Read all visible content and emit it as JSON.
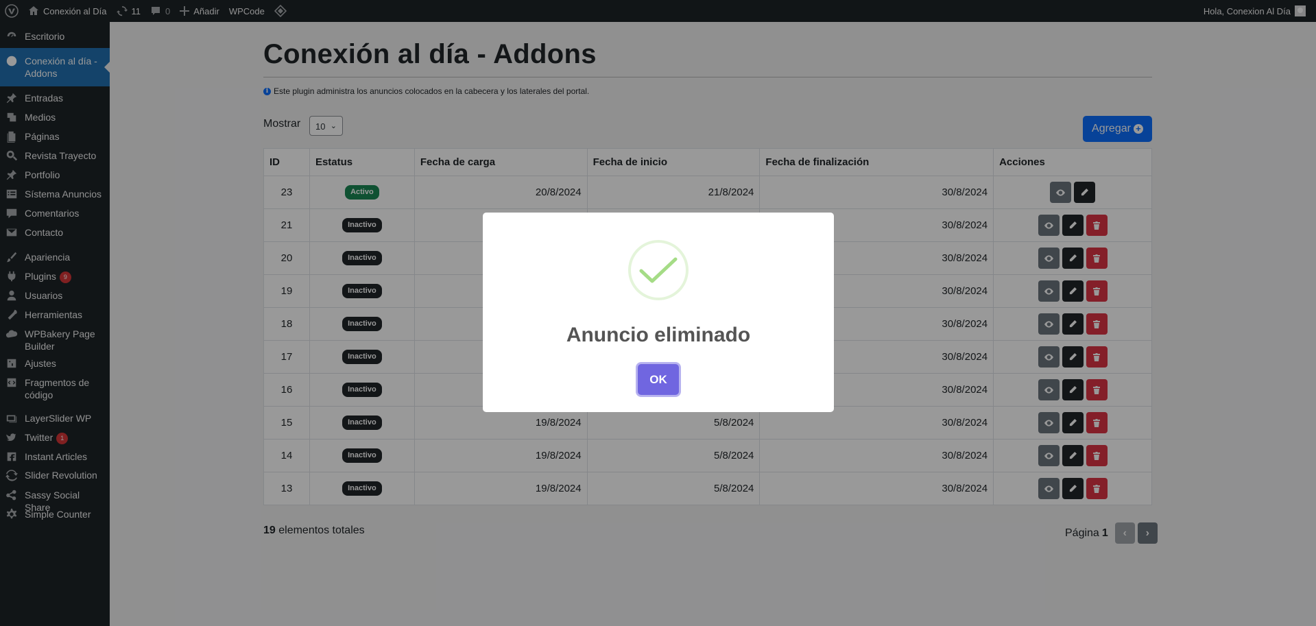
{
  "adminbar": {
    "site_name": "Conexión al Día",
    "updates_count": "11",
    "comments_count": "0",
    "add_new_label": "Añadir",
    "wpcode_label": "WPCode",
    "greeting": "Hola, Conexion Al Día"
  },
  "sidebar": {
    "items": [
      {
        "label": "Escritorio",
        "icon": "dashboard-icon"
      },
      {
        "label": "Conexión al día - Addons",
        "icon": "addons-icon",
        "current": true
      },
      {
        "label": "Entradas",
        "icon": "pin-icon"
      },
      {
        "label": "Medios",
        "icon": "media-icon"
      },
      {
        "label": "Páginas",
        "icon": "pages-icon"
      },
      {
        "label": "Revista Trayecto",
        "icon": "magnify-icon"
      },
      {
        "label": "Portfolio",
        "icon": "pin-icon"
      },
      {
        "label": "Sístema Anuncios",
        "icon": "list-icon"
      },
      {
        "label": "Comentarios",
        "icon": "comment-icon"
      },
      {
        "label": "Contacto",
        "icon": "mail-icon"
      },
      {
        "label": "Apariencia",
        "icon": "brush-icon"
      },
      {
        "label": "Plugins",
        "icon": "plugin-icon",
        "badge": "9"
      },
      {
        "label": "Usuarios",
        "icon": "user-icon"
      },
      {
        "label": "Herramientas",
        "icon": "wrench-icon"
      },
      {
        "label": "WPBakery Page Builder",
        "icon": "cloud-icon"
      },
      {
        "label": "Ajustes",
        "icon": "settings-icon"
      },
      {
        "label": "Fragmentos de código",
        "icon": "code-icon"
      },
      {
        "label": "LayerSlider WP",
        "icon": "layers-icon"
      },
      {
        "label": "Twitter",
        "icon": "twitter-icon",
        "badge": "1"
      },
      {
        "label": "Instant Articles",
        "icon": "facebook-icon"
      },
      {
        "label": "Slider Revolution",
        "icon": "refresh-icon"
      },
      {
        "label": "Sassy Social Share",
        "icon": "share-icon"
      },
      {
        "label": "Simple Counter",
        "icon": "gear-icon"
      }
    ]
  },
  "page": {
    "title": "Conexión al día - Addons",
    "info": "Este plugin administra los anuncios colocados en la cabecera y los laterales del portal.",
    "show_label": "Mostrar",
    "page_size": "10",
    "add_button": "Agregar"
  },
  "table": {
    "headers": [
      "ID",
      "Estatus",
      "Fecha de carga",
      "Fecha de inicio",
      "Fecha de finalización",
      "Acciones"
    ],
    "rows": [
      {
        "id": "23",
        "status": "Activo",
        "loaded": "20/8/2024",
        "start": "21/8/2024",
        "end": "30/8/2024"
      },
      {
        "id": "21",
        "status": "Inactivo",
        "loaded": "",
        "start": "",
        "end": "30/8/2024"
      },
      {
        "id": "20",
        "status": "Inactivo",
        "loaded": "",
        "start": "",
        "end": "30/8/2024"
      },
      {
        "id": "19",
        "status": "Inactivo",
        "loaded": "",
        "start": "",
        "end": "30/8/2024"
      },
      {
        "id": "18",
        "status": "Inactivo",
        "loaded": "",
        "start": "",
        "end": "30/8/2024"
      },
      {
        "id": "17",
        "status": "Inactivo",
        "loaded": "",
        "start": "",
        "end": "30/8/2024"
      },
      {
        "id": "16",
        "status": "Inactivo",
        "loaded": "",
        "start": "",
        "end": "30/8/2024"
      },
      {
        "id": "15",
        "status": "Inactivo",
        "loaded": "19/8/2024",
        "start": "5/8/2024",
        "end": "30/8/2024"
      },
      {
        "id": "14",
        "status": "Inactivo",
        "loaded": "19/8/2024",
        "start": "5/8/2024",
        "end": "30/8/2024"
      },
      {
        "id": "13",
        "status": "Inactivo",
        "loaded": "19/8/2024",
        "start": "5/8/2024",
        "end": "30/8/2024"
      }
    ]
  },
  "footer": {
    "total_count": "19",
    "total_label": "elementos totales",
    "page_label": "Página",
    "page_number": "1"
  },
  "modal": {
    "title": "Anuncio eliminado",
    "ok_label": "OK",
    "icon": "success-check-icon"
  },
  "colors": {
    "primary": "#0d6efd",
    "wp_blue": "#2271b1",
    "active": "#198754",
    "danger": "#dc3545",
    "modal_button": "#7066e0",
    "check": "#a5dc86"
  }
}
